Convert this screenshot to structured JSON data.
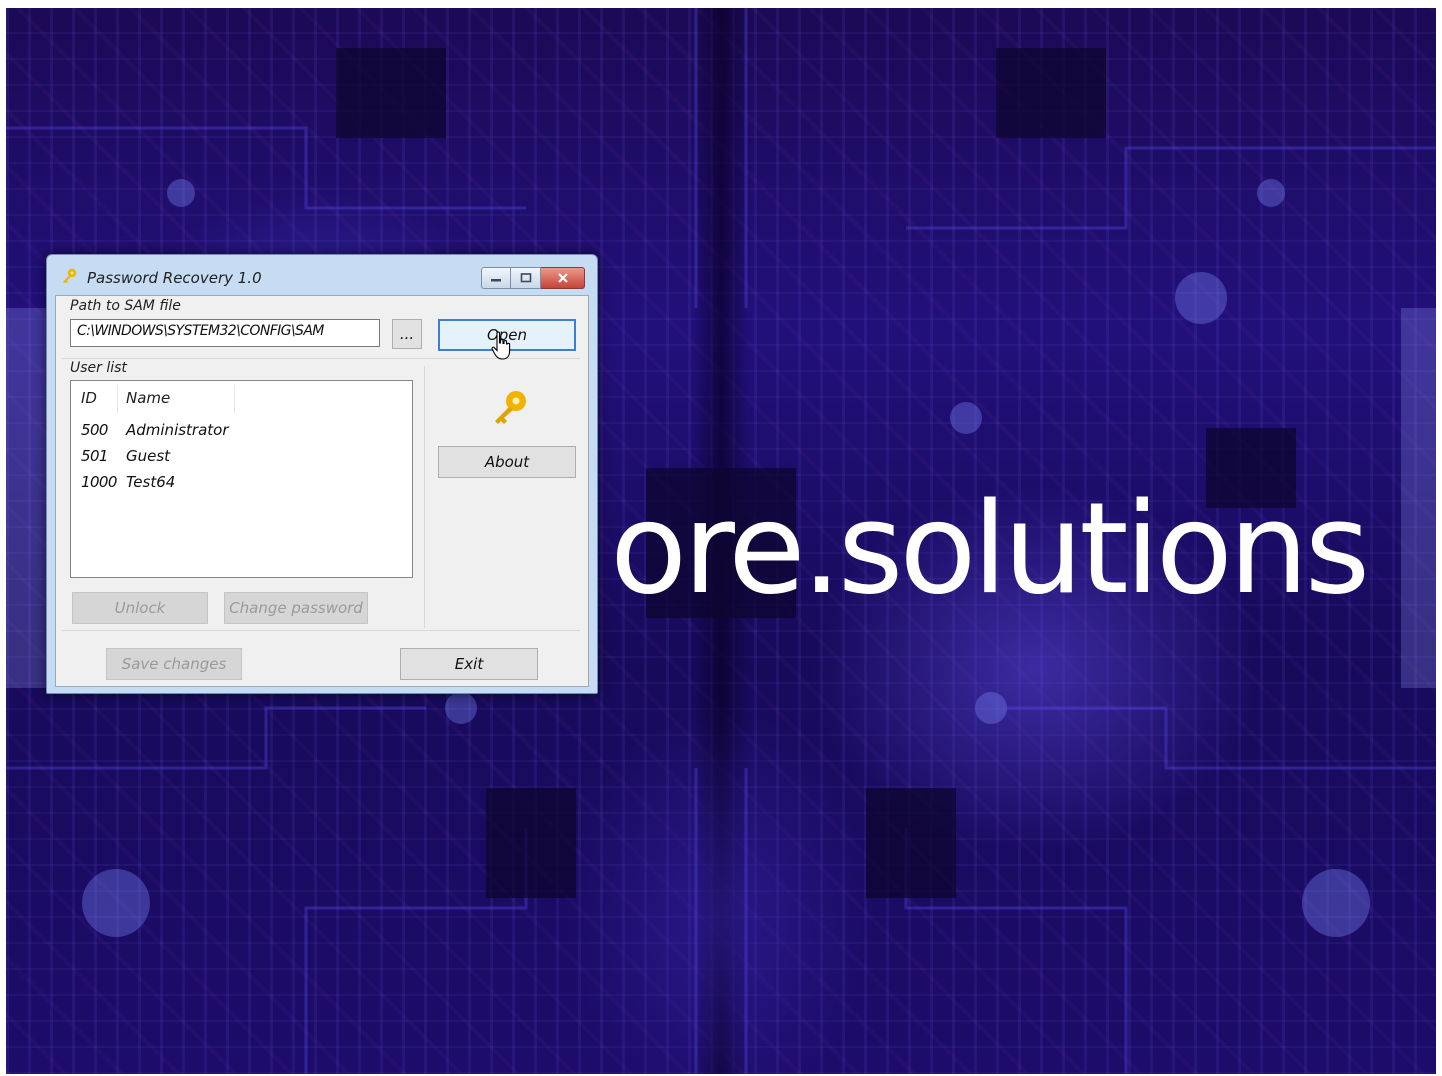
{
  "desktop": {
    "brand_text": "ore.solutions"
  },
  "window": {
    "title": "Password Recovery 1.0",
    "title_icon": "key-icon",
    "controls": [
      "minimize",
      "maximize",
      "close"
    ],
    "sam_path_label": "Path to SAM file",
    "sam_path_value": "C:\\WINDOWS\\SYSTEM32\\CONFIG\\SAM",
    "browse_label": "...",
    "open_label": "Open",
    "user_list_label": "User list",
    "columns": [
      "ID",
      "Name"
    ],
    "users": [
      {
        "id": "500",
        "name": "Administrator"
      },
      {
        "id": "501",
        "name": "Guest"
      },
      {
        "id": "1000",
        "name": "Test64"
      }
    ],
    "about_label": "About",
    "unlock_label": "Unlock",
    "change_password_label": "Change password",
    "save_changes_label": "Save changes",
    "exit_label": "Exit"
  },
  "colors": {
    "accent_focus": "#3c7fd1",
    "key_icon": "#f0b400",
    "close_button": "#c6443a",
    "desktop_base": "#1d0c6a"
  }
}
